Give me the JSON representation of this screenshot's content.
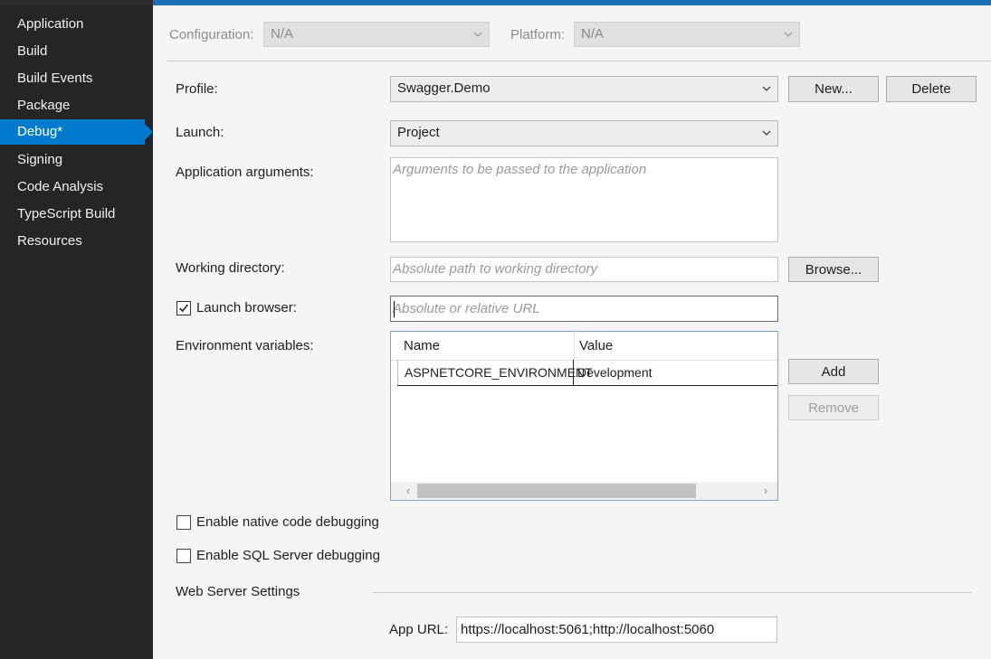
{
  "sidebar": {
    "items": [
      {
        "label": "Application",
        "active": false
      },
      {
        "label": "Build",
        "active": false
      },
      {
        "label": "Build Events",
        "active": false
      },
      {
        "label": "Package",
        "active": false
      },
      {
        "label": "Debug*",
        "active": true
      },
      {
        "label": "Signing",
        "active": false
      },
      {
        "label": "Code Analysis",
        "active": false
      },
      {
        "label": "TypeScript Build",
        "active": false
      },
      {
        "label": "Resources",
        "active": false
      }
    ]
  },
  "config_bar": {
    "configuration_label": "Configuration:",
    "configuration_value": "N/A",
    "platform_label": "Platform:",
    "platform_value": "N/A"
  },
  "profile": {
    "label": "Profile:",
    "value": "Swagger.Demo",
    "new_button": "New...",
    "delete_button": "Delete"
  },
  "launch": {
    "label": "Launch:",
    "value": "Project"
  },
  "app_args": {
    "label": "Application arguments:",
    "placeholder": "Arguments to be passed to the application"
  },
  "working_dir": {
    "label": "Working directory:",
    "placeholder": "Absolute path to working directory",
    "browse_button": "Browse..."
  },
  "launch_browser": {
    "label": "Launch browser:",
    "checked": true,
    "placeholder": "Absolute or relative URL"
  },
  "env_vars": {
    "label": "Environment variables:",
    "columns": [
      "Name",
      "Value"
    ],
    "rows": [
      {
        "name": "ASPNETCORE_ENVIRONMENT",
        "value": "Development"
      }
    ],
    "add_button": "Add",
    "remove_button": "Remove"
  },
  "native_debug": {
    "label": "Enable native code debugging",
    "checked": false
  },
  "sql_debug": {
    "label": "Enable SQL Server debugging",
    "checked": false
  },
  "web_server": {
    "heading": "Web Server Settings",
    "app_url_label": "App URL:",
    "app_url_value": "https://localhost:5061;http://localhost:5060"
  },
  "colors": {
    "accent": "#007acc",
    "sidebar_bg": "#252526",
    "content_bg": "#f5f5f5"
  }
}
